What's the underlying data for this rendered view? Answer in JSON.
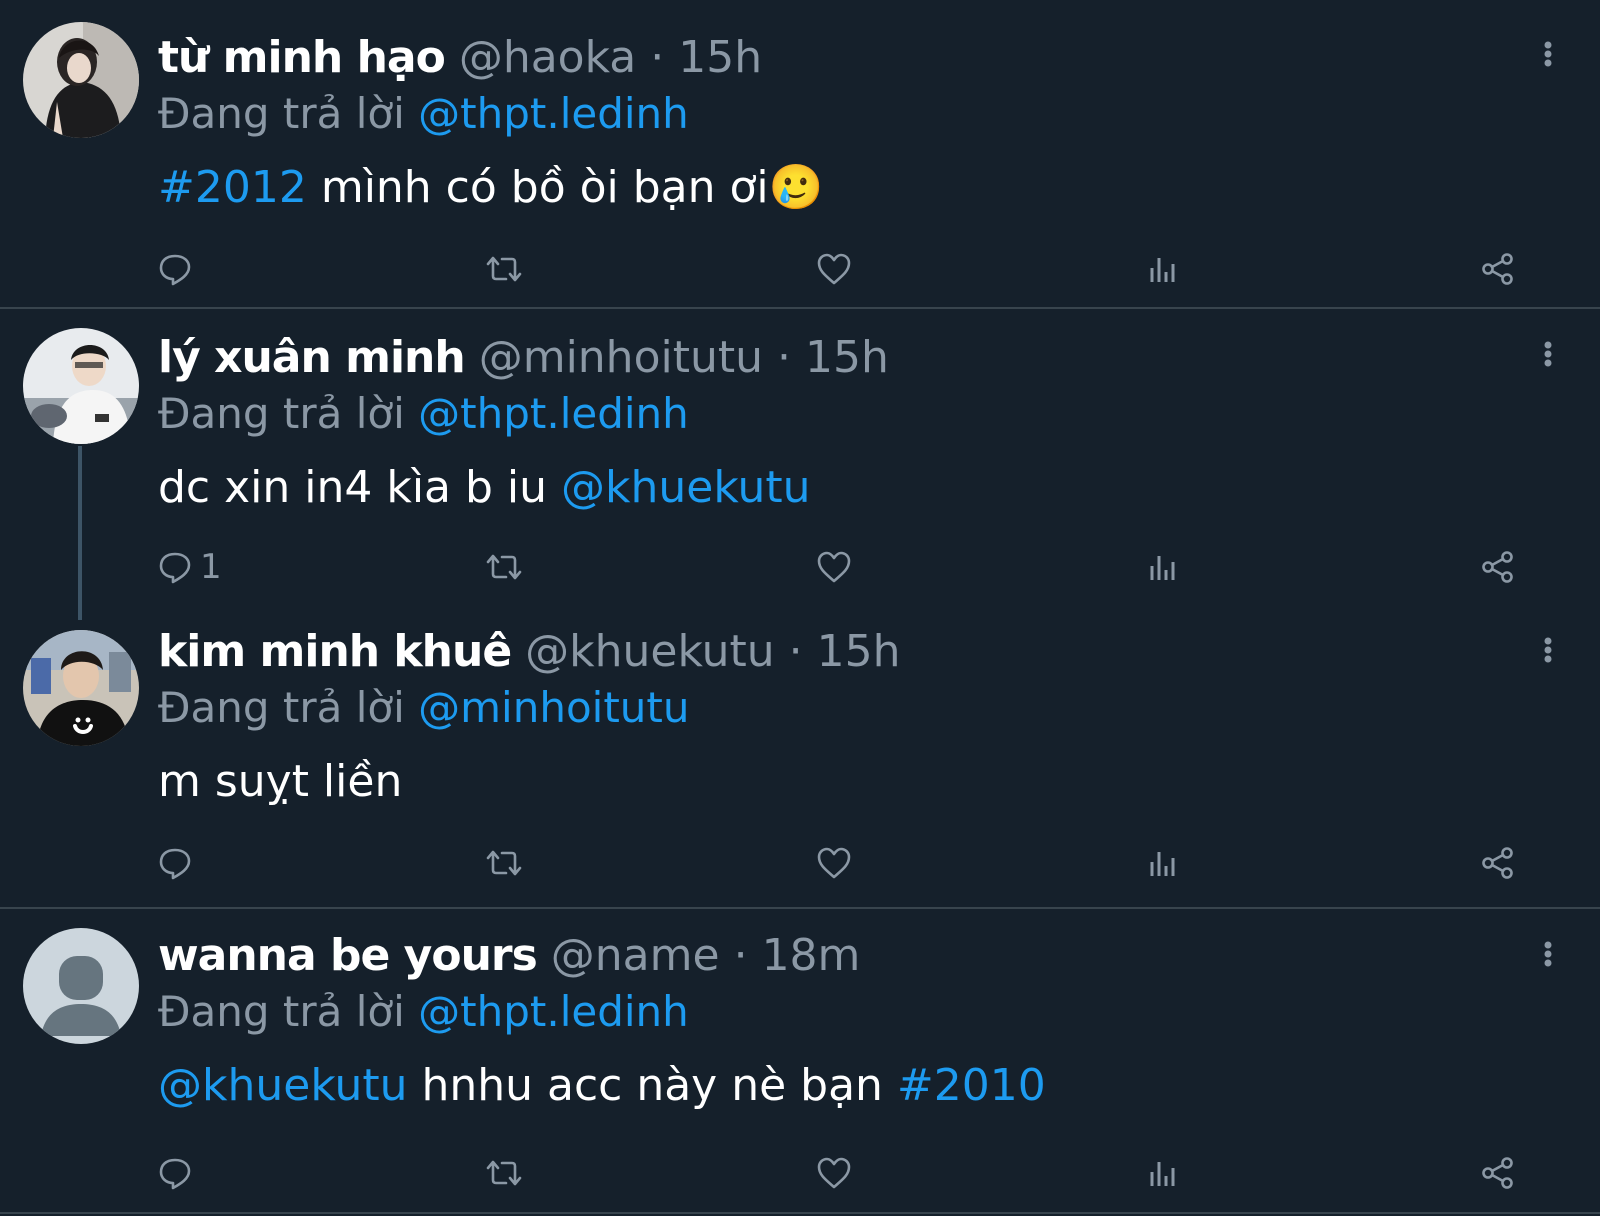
{
  "tweets": [
    {
      "name": "từ minh hạo",
      "handle": "@haoka",
      "separator": "·",
      "time": "15h",
      "reply_label": "Đang trả lời",
      "reply_to": "@thpt.ledinh",
      "body_prefix": "#2012",
      "body_text": " mình có bồ òi bạn ơi",
      "body_emoji": "🥲",
      "reply_count": ""
    },
    {
      "name": "lý xuân minh",
      "handle": "@minhoitutu",
      "separator": "·",
      "time": "15h",
      "reply_label": "Đang trả lời",
      "reply_to": "@thpt.ledinh",
      "body_text": "dc xin in4 kìa b iu ",
      "body_mention": "@khuekutu",
      "reply_count": "1"
    },
    {
      "name": "kim minh khuê",
      "handle": "@khuekutu",
      "separator": "·",
      "time": "15h",
      "reply_label": "Đang trả lời",
      "reply_to": "@minhoitutu",
      "body_text": "m suỵt liền",
      "reply_count": ""
    },
    {
      "name": "wanna be yours",
      "handle": "@name",
      "separator": "·",
      "time": "18m",
      "reply_label": "Đang trả lời",
      "reply_to": "@thpt.ledinh",
      "body_mention": "@khuekutu",
      "body_text": " hnhu acc này nè bạn ",
      "body_hashtag": "#2010",
      "reply_count": ""
    }
  ],
  "icons": {
    "reply": "reply-icon",
    "retweet": "retweet-icon",
    "like": "heart-icon",
    "views": "views-icon",
    "share": "share-icon",
    "more": "more-vertical-icon"
  },
  "colors": {
    "background": "#15202b",
    "text": "#ffffff",
    "muted": "#8b98a5",
    "link": "#1d9bf0",
    "divider": "#38444d"
  }
}
